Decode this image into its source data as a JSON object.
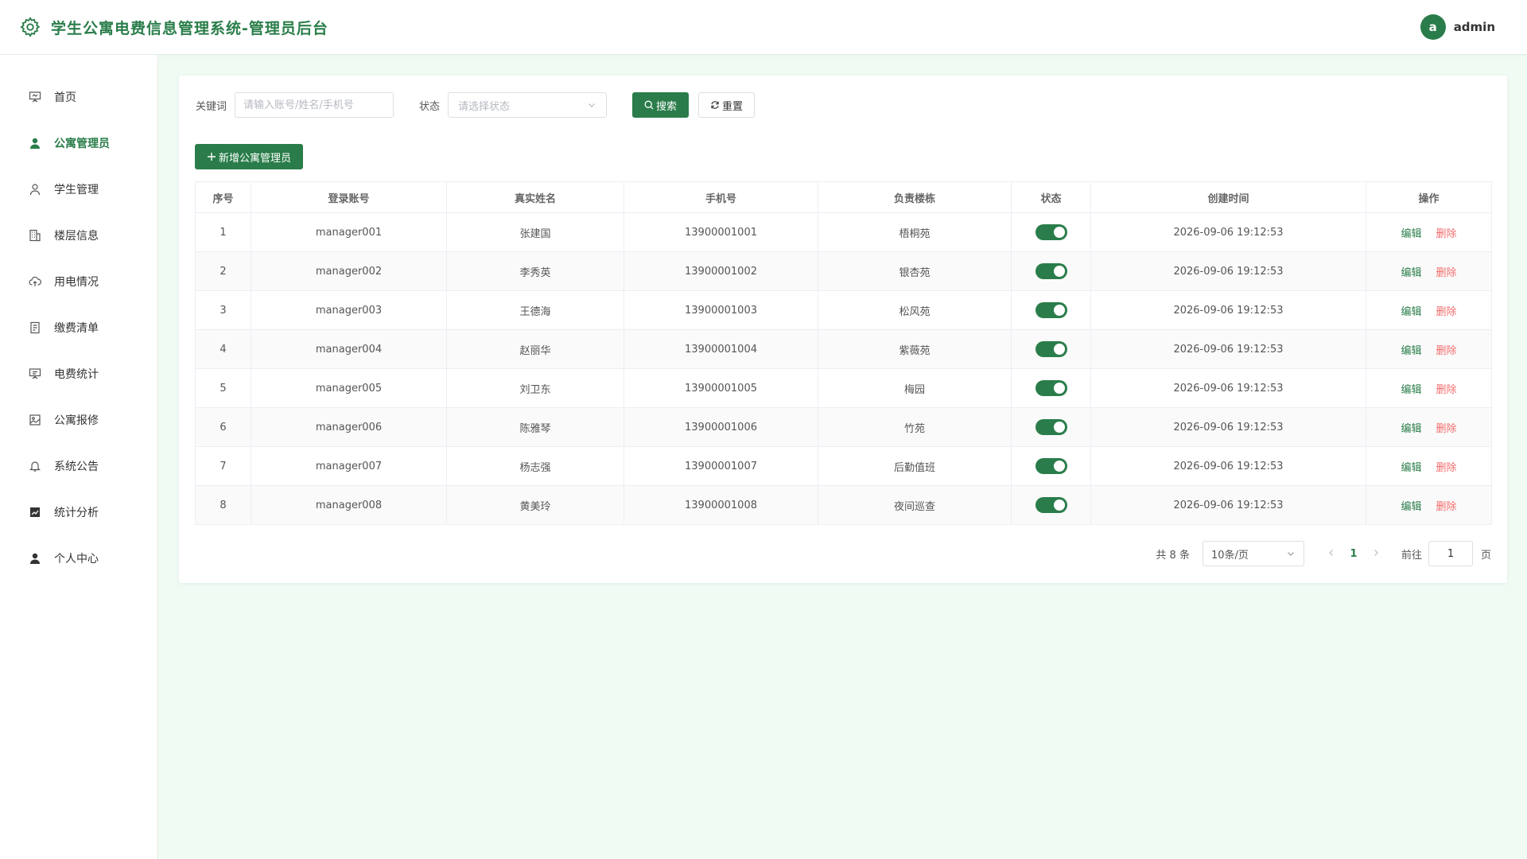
{
  "header": {
    "title": "学生公寓电费信息管理系统-管理员后台",
    "avatar_letter": "a",
    "username": "admin"
  },
  "sidebar": {
    "items": [
      {
        "label": "首页",
        "icon": "presentation-icon"
      },
      {
        "label": "公寓管理员",
        "icon": "user-filled-icon"
      },
      {
        "label": "学生管理",
        "icon": "user-icon"
      },
      {
        "label": "楼层信息",
        "icon": "building-icon"
      },
      {
        "label": "用电情况",
        "icon": "cloud-upload-icon"
      },
      {
        "label": "缴费清单",
        "icon": "document-icon"
      },
      {
        "label": "电费统计",
        "icon": "board-icon"
      },
      {
        "label": "公寓报修",
        "icon": "picture-icon"
      },
      {
        "label": "系统公告",
        "icon": "bell-icon"
      },
      {
        "label": "统计分析",
        "icon": "chart-icon"
      },
      {
        "label": "个人中心",
        "icon": "user-filled-icon"
      }
    ],
    "active_index": 1
  },
  "search": {
    "keyword_label": "关键词",
    "keyword_placeholder": "请输入账号/姓名/手机号",
    "status_label": "状态",
    "status_placeholder": "请选择状态",
    "search_button": "搜索",
    "reset_button": "重置"
  },
  "toolbar": {
    "add_button": "新增公寓管理员"
  },
  "table": {
    "columns": [
      "序号",
      "登录账号",
      "真实姓名",
      "手机号",
      "负责楼栋",
      "状态",
      "创建时间",
      "操作"
    ],
    "rows": [
      {
        "index": "1",
        "account": "manager001",
        "name": "张建国",
        "phone": "13900001001",
        "building": "梧桐苑",
        "status": true,
        "created": "2026-09-06 19:12:53"
      },
      {
        "index": "2",
        "account": "manager002",
        "name": "李秀英",
        "phone": "13900001002",
        "building": "银杏苑",
        "status": true,
        "created": "2026-09-06 19:12:53"
      },
      {
        "index": "3",
        "account": "manager003",
        "name": "王德海",
        "phone": "13900001003",
        "building": "松风苑",
        "status": true,
        "created": "2026-09-06 19:12:53"
      },
      {
        "index": "4",
        "account": "manager004",
        "name": "赵丽华",
        "phone": "13900001004",
        "building": "紫薇苑",
        "status": true,
        "created": "2026-09-06 19:12:53"
      },
      {
        "index": "5",
        "account": "manager005",
        "name": "刘卫东",
        "phone": "13900001005",
        "building": "梅园",
        "status": true,
        "created": "2026-09-06 19:12:53"
      },
      {
        "index": "6",
        "account": "manager006",
        "name": "陈雅琴",
        "phone": "13900001006",
        "building": "竹苑",
        "status": true,
        "created": "2026-09-06 19:12:53"
      },
      {
        "index": "7",
        "account": "manager007",
        "name": "杨志强",
        "phone": "13900001007",
        "building": "后勤值班",
        "status": true,
        "created": "2026-09-06 19:12:53"
      },
      {
        "index": "8",
        "account": "manager008",
        "name": "黄美玲",
        "phone": "13900001008",
        "building": "夜间巡查",
        "status": true,
        "created": "2026-09-06 19:12:53"
      }
    ],
    "edit_label": "编辑",
    "delete_label": "删除"
  },
  "pagination": {
    "total_text": "共 8 条",
    "page_size": "10条/页",
    "current_page": "1",
    "goto_label": "前往",
    "goto_value": "1",
    "page_unit": "页"
  },
  "colors": {
    "accent": "#2a7d4a",
    "danger": "#f56c6c",
    "background": "#f0fbf4"
  }
}
